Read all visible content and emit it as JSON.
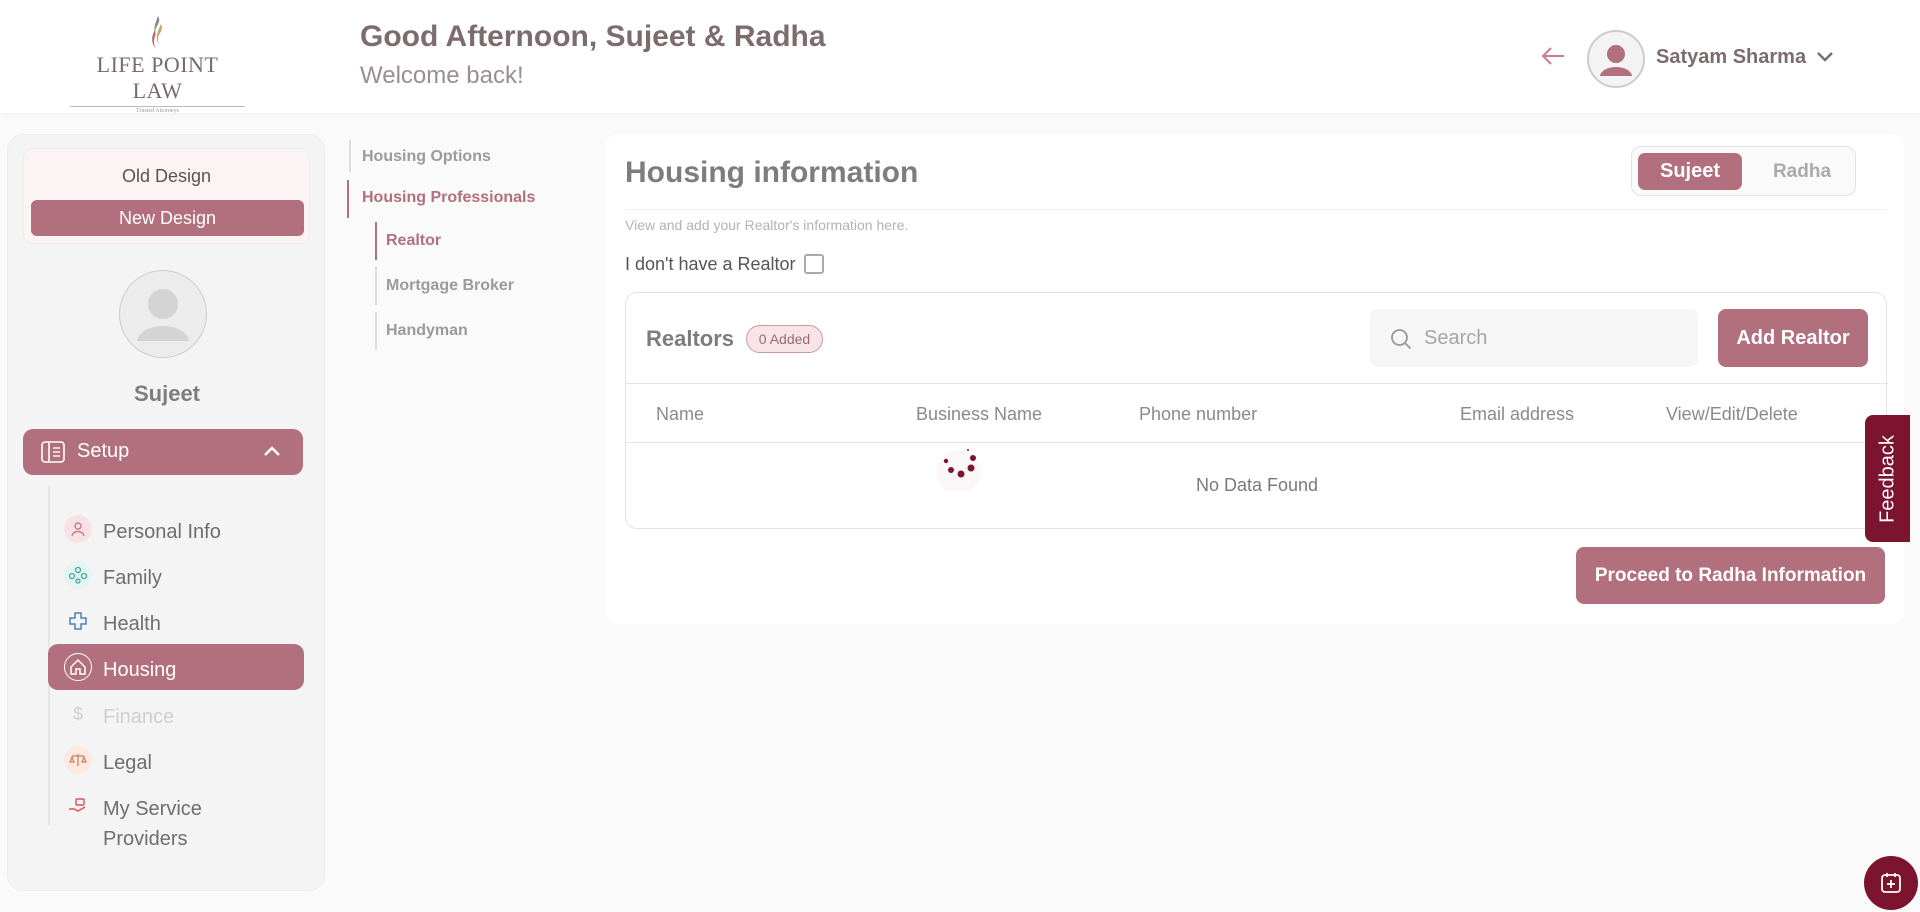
{
  "header": {
    "logo_text": "LIFE POINT LAW",
    "logo_tagline": "Trusted Attorneys",
    "greeting": "Good Afternoon, Sujeet & Radha",
    "welcome": "Welcome back!",
    "user_name": "Satyam Sharma"
  },
  "sidebar": {
    "old_design": "Old Design",
    "new_design": "New Design",
    "profile_name": "Sujeet",
    "setup_label": "Setup",
    "items": [
      {
        "label": "Personal Info",
        "icon": "person-icon"
      },
      {
        "label": "Family",
        "icon": "family-icon"
      },
      {
        "label": "Health",
        "icon": "health-cross-icon"
      },
      {
        "label": "Housing",
        "icon": "house-icon",
        "active": true
      },
      {
        "label": "Finance",
        "icon": "dollar-icon",
        "disabled": true
      },
      {
        "label": "Legal",
        "icon": "scales-icon"
      },
      {
        "label": "My Service Providers",
        "icon": "service-hand-icon"
      }
    ]
  },
  "subnav": {
    "housing_options": "Housing Options",
    "housing_professionals": "Housing Professionals",
    "realtor": "Realtor",
    "mortgage_broker": "Mortgage Broker",
    "handyman": "Handyman"
  },
  "main": {
    "title": "Housing information",
    "toggle_sujeet": "Sujeet",
    "toggle_radha": "Radha",
    "description": "View and add your Realtor's information here.",
    "no_realtor_label": "I don't have a Realtor",
    "realtors_title": "Realtors",
    "added_badge": "0 Added",
    "search_placeholder": "Search",
    "add_button": "Add Realtor",
    "columns": [
      "Name",
      "Business Name",
      "Phone number",
      "Email address",
      "View/Edit/Delete"
    ],
    "no_data": "No Data Found",
    "proceed_button": "Proceed to Radha Information"
  },
  "feedback_label": "Feedback",
  "colors": {
    "accent": "#b26f7d",
    "dark_accent": "#7c1430"
  }
}
